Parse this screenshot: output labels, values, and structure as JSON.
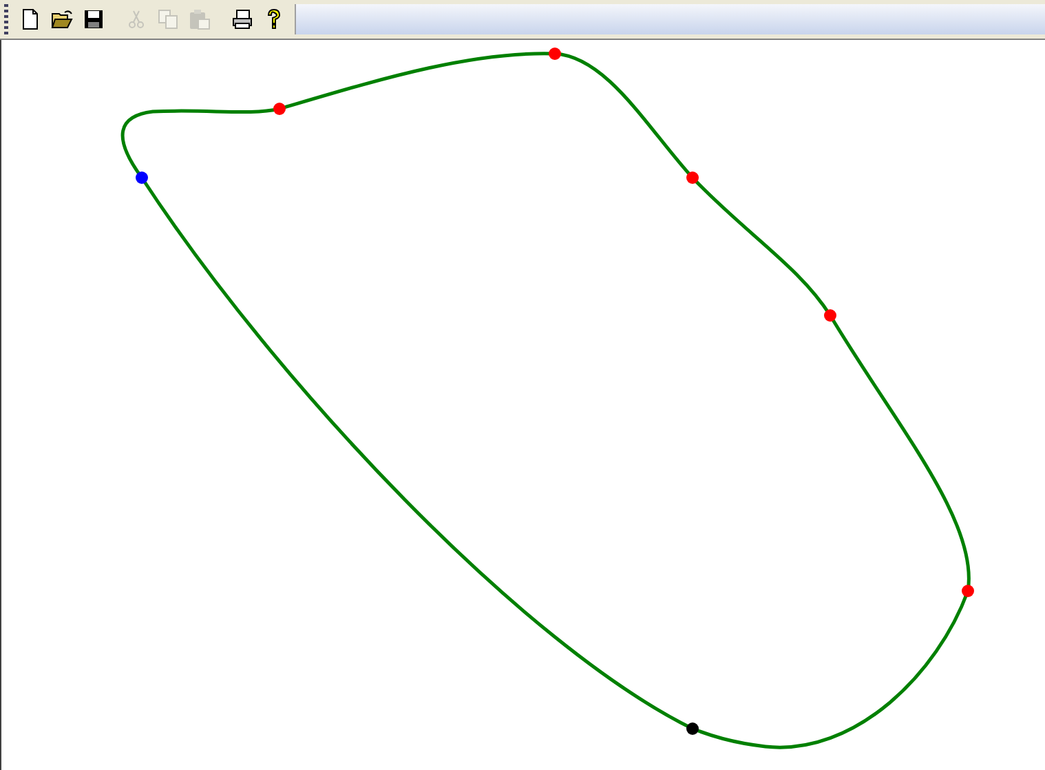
{
  "toolbar": {
    "buttons": [
      {
        "kind": "new",
        "disabled": false
      },
      {
        "kind": "open",
        "disabled": false
      },
      {
        "kind": "save",
        "disabled": false
      },
      {
        "kind": "cut",
        "disabled": true
      },
      {
        "kind": "copy",
        "disabled": true
      },
      {
        "kind": "paste",
        "disabled": true
      },
      {
        "kind": "print",
        "disabled": false
      },
      {
        "kind": "help",
        "disabled": false
      }
    ]
  },
  "canvas": {
    "points": [
      {
        "color": "#0000ff"
      },
      {
        "color": "#ff0000"
      },
      {
        "color": "#ff0000"
      },
      {
        "color": "#ff0000"
      },
      {
        "color": "#ff0000"
      },
      {
        "color": "#ff0000"
      },
      {
        "color": "#000000"
      }
    ]
  }
}
